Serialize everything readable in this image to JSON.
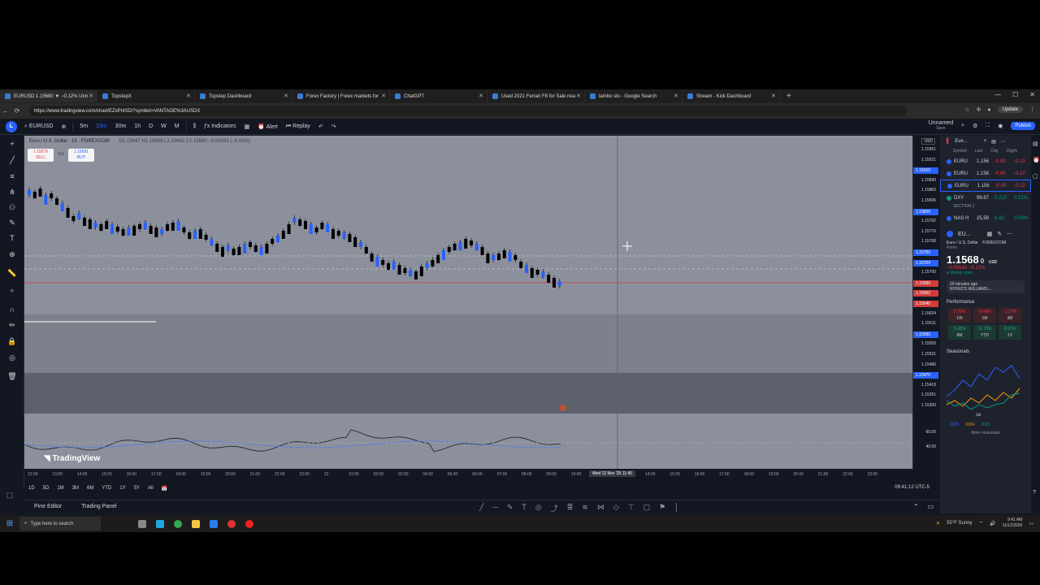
{
  "browser": {
    "tabs": [
      {
        "label": "EURUSD 1.15680 ▼ −0.12% Unn",
        "active": true
      },
      {
        "label": "TopstepX",
        "active": false
      },
      {
        "label": "Topstep Dashboard",
        "active": false
      },
      {
        "label": "Forex Factory | Forex markets for",
        "active": false
      },
      {
        "label": "ChatGPT",
        "active": false
      },
      {
        "label": "Used 2021 Ferrari F8 for Sale nea",
        "active": false
      },
      {
        "label": "lambo sto - Google Search",
        "active": false
      },
      {
        "label": "Stream - Kick Dashboard",
        "active": false
      }
    ],
    "url": "https://www.tradingview.com/chart/EZxPnlSD/?symbol=VANTAGE%3AUSDX",
    "update_label": "Update"
  },
  "toolbar": {
    "logo": "L",
    "symbol": "EURUSD",
    "intervals": [
      "5m",
      "15m",
      "30m",
      "1h",
      "D",
      "W",
      "M"
    ],
    "active_interval": "15m",
    "indicators_label": "Indicators",
    "alert_label": "Alert",
    "replay_label": "Replay",
    "layout_name": "Unnamed",
    "layout_sub": "Save",
    "publish_label": "Publish"
  },
  "chart": {
    "symbol_title": "Euro / U.S. Dollar · 15 · FOREXCOM",
    "ohlc": "O1.15647 H1.15689 L1.15642 C1.15680 −0.00033 (−0.03%)",
    "sell_price": "1.15679",
    "sell_label": "SELL",
    "spread": "0.1",
    "buy_price": "1.15681",
    "buy_label": "BUY",
    "currency": "USD",
    "watermark": "TradingView",
    "price_labels": [
      "1.15951",
      "1.15921",
      "1.15910",
      "1.15890",
      "1.15860",
      "1.15845",
      "1.15820",
      "1.15792",
      "1.15776",
      "1.15768",
      "1.15750",
      "1.15704",
      "1.15700",
      "1.15680",
      "1.15662",
      "1.15640",
      "1.15634",
      "1.15611",
      "1.15590",
      "1.15550",
      "1.15531",
      "1.15486",
      "1.15470",
      "1.15418",
      "1.15351",
      "1.15300"
    ],
    "osc_labels": [
      "60.00",
      "40.00"
    ],
    "time_labels": [
      "12:00",
      "13:00",
      "14:00",
      "15:00",
      "16:00",
      "17:00",
      "18:00",
      "19:00",
      "20:00",
      "21:00",
      "22:00",
      "23:00",
      "12",
      "01:00",
      "02:00",
      "03:00",
      "04:00",
      "05:00",
      "06:00",
      "07:00",
      "08:00",
      "09:00",
      "10:00",
      "12:00",
      "13:00",
      "14:00",
      "15:00",
      "16:00",
      "17:00",
      "18:00",
      "19:00",
      "20:00",
      "21:00",
      "22:00",
      "23:00"
    ],
    "cursor_time": "Wed 12 Nov '25   11:45",
    "ranges": [
      "1D",
      "5D",
      "1M",
      "3M",
      "6M",
      "YTD",
      "1Y",
      "5Y",
      "All"
    ],
    "clock": "09:41:12 UTC-5"
  },
  "bottom": {
    "pine_label": "Pine Editor",
    "trading_label": "Trading Panel"
  },
  "watchlist": {
    "title": "Eve...",
    "columns": [
      "Symbol",
      "Last",
      "Chg",
      "Chg%"
    ],
    "rows": [
      {
        "sym": "EURU",
        "last": "1.156",
        "chg": "-0.00",
        "pct": "-0.13",
        "color": "#f23645"
      },
      {
        "sym": "EURU",
        "last": "1.156",
        "chg": "-0.00",
        "pct": "-0.12",
        "color": "#f23645"
      },
      {
        "sym": "EURU",
        "last": "1.156",
        "chg": "-0.00",
        "pct": "-0.12",
        "color": "#f23645"
      },
      {
        "sym": "DXY",
        "last": "99.67",
        "chg": "0.210",
        "pct": "0.21%",
        "color": "#089981"
      }
    ],
    "section_label": "SECTION 1",
    "extra_row": {
      "sym": "NAS H",
      "last": "25,58",
      "chg": "6.43",
      "pct": "0.03%"
    },
    "detail": {
      "short": "EU...",
      "name": "Euro / U.S. Dollar",
      "exchange": "FOREXCOM",
      "type": "Forex",
      "price": "1.1568",
      "price_tail": "0",
      "ccy": "USD",
      "change": "−0.00143",
      "change_pct": "−0.12%",
      "market": "Market open",
      "news_time": "20 minutes ago",
      "news_text": "NYFED'S WILLIAMS:..."
    },
    "performance_label": "Performance",
    "performance": [
      {
        "v": "0.72%",
        "p": "1W",
        "pos": false
      },
      {
        "v": "-0.48%",
        "p": "1M",
        "pos": false
      },
      {
        "v": "-1.17%",
        "p": "3M",
        "pos": false
      },
      {
        "v": "3.42%",
        "p": "6M",
        "pos": true
      },
      {
        "v": "11.73%",
        "p": "YTD",
        "pos": true
      },
      {
        "v": "8.57%",
        "p": "1Y",
        "pos": true
      }
    ],
    "seasonals_label": "Seasonals",
    "seasonals_month": "Jul",
    "seasonals_legend": [
      "2025",
      "2024",
      "2023"
    ],
    "seasonals_link": "More seasonals"
  },
  "taskbar": {
    "search_placeholder": "Type here to search",
    "weather": "55°F  Sunny",
    "time": "9:41 AM",
    "date": "11/12/2025"
  },
  "colors": {
    "chart_bg": "#8c909c",
    "bull": "#2962ff",
    "bear": "#000000",
    "accent": "#2962ff"
  }
}
